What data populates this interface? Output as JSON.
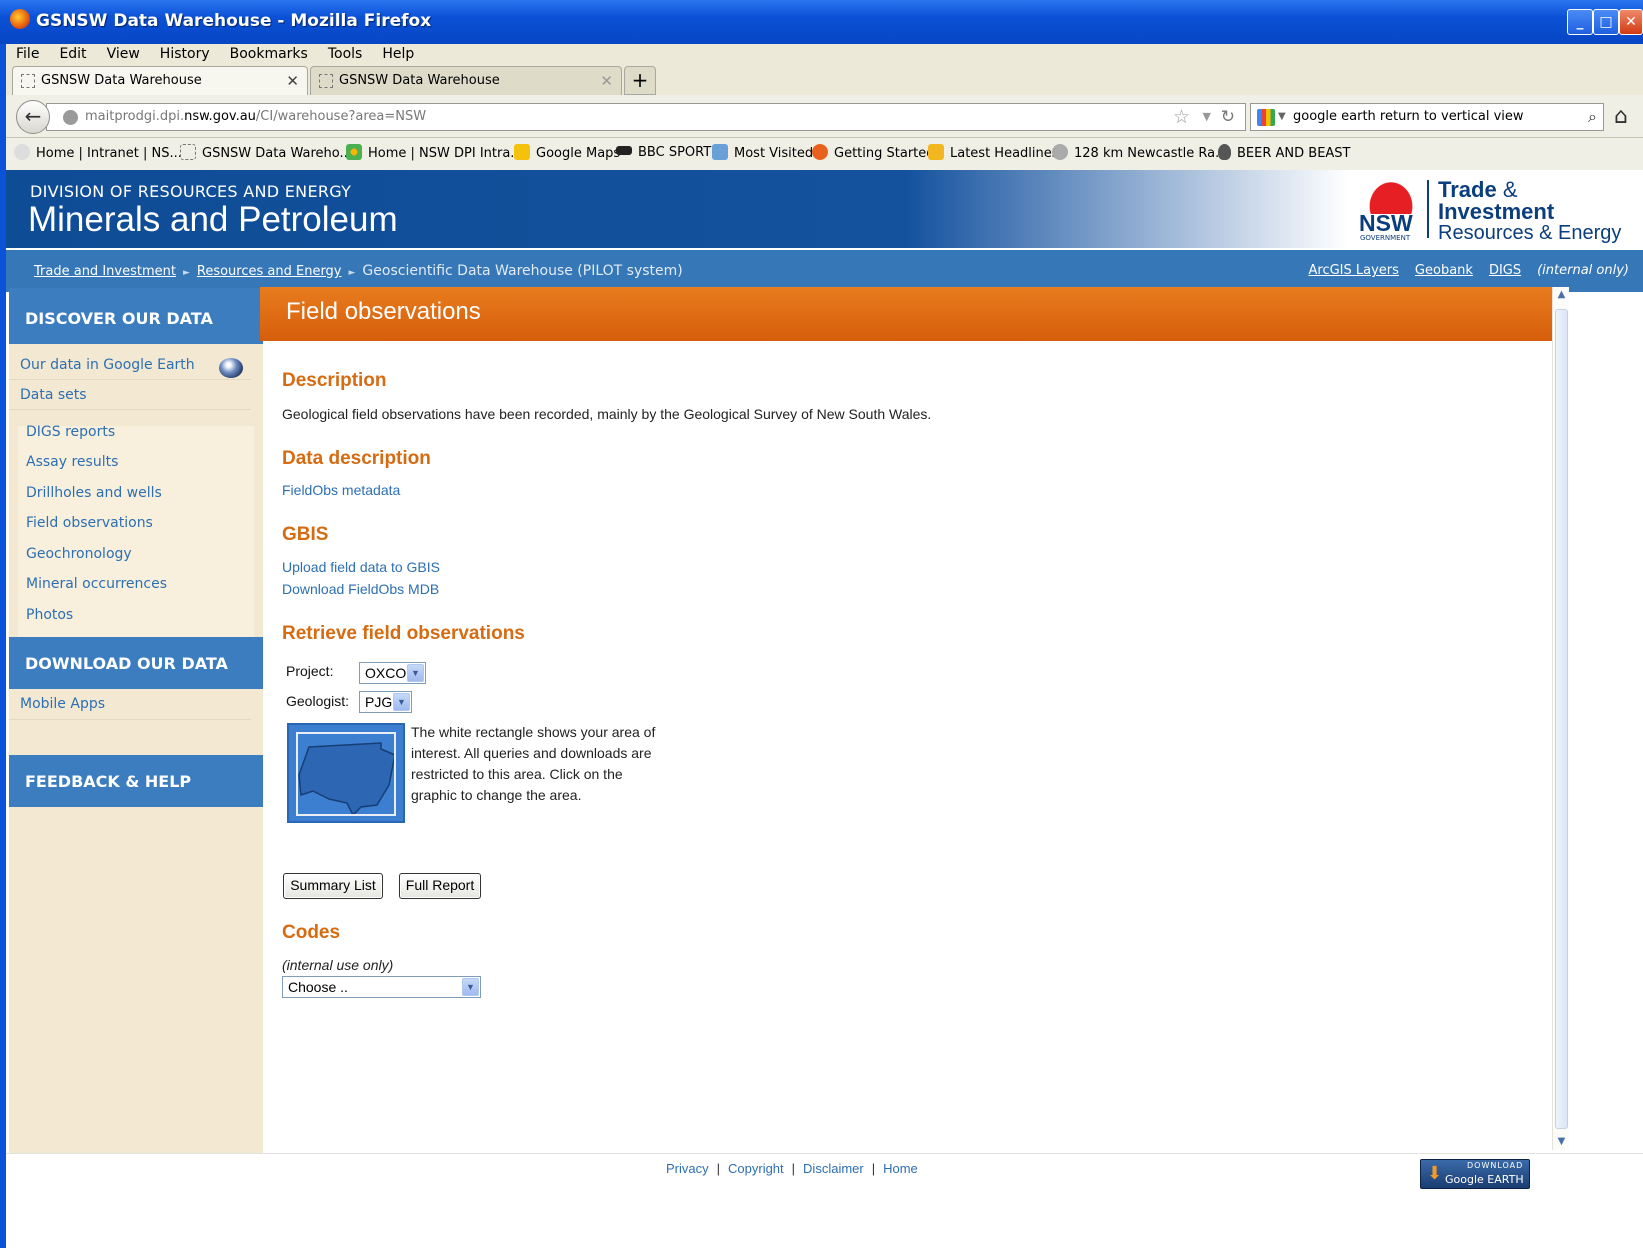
{
  "window": {
    "title": "GSNSW Data Warehouse - Mozilla Firefox"
  },
  "menu": [
    "File",
    "Edit",
    "View",
    "History",
    "Bookmarks",
    "Tools",
    "Help"
  ],
  "tabs": [
    {
      "label": "GSNSW Data Warehouse",
      "active": true
    },
    {
      "label": "GSNSW Data Warehouse",
      "active": false
    }
  ],
  "nav": {
    "url_prefix": "maitprodgi.dpi.",
    "url_domain": "nsw.gov.au",
    "url_path": "/CI/warehouse?area=NSW",
    "search_value": "google earth return to vertical view"
  },
  "bookmarks": [
    "Home | Intranet | NS...",
    "GSNSW Data Wareho...",
    "Home | NSW DPI Intra...",
    "Google Maps",
    "BBC SPORT",
    "Most Visited",
    "Getting Started",
    "Latest Headlines",
    "128 km Newcastle Ra...",
    "BEER AND BEAST"
  ],
  "banner": {
    "division": "DIVISION OF RESOURCES AND ENERGY",
    "title": "Minerals and Petroleum",
    "logo_nsw": "NSW",
    "logo_gov": "GOVERNMENT",
    "logo_trade": "Trade",
    "logo_amp": "&",
    "logo_investment": "Investment",
    "logo_resources": "Resources & Energy"
  },
  "breadcrumb": {
    "items": [
      "Trade and Investment",
      "Resources and Energy"
    ],
    "current": "Geoscientific Data Warehouse (PILOT system)",
    "right_links": [
      "ArcGIS Layers",
      "Geobank",
      "DIGS"
    ],
    "right_note": "(internal only)"
  },
  "sidebar": {
    "discover_heading": "DISCOVER OUR DATA",
    "top_items": [
      "Our data in Google Earth",
      "Data sets"
    ],
    "dataset_items": [
      "DIGS reports",
      "Assay results",
      "Drillholes and wells",
      "Field observations",
      "Geochronology",
      "Mineral occurrences",
      "Photos"
    ],
    "download_heading": "DOWNLOAD OUR DATA",
    "download_items": [
      "Mobile Apps"
    ],
    "feedback_heading": "FEEDBACK & HELP"
  },
  "main": {
    "page_title": "Field observations",
    "description_heading": "Description",
    "description_text": "Geological field observations have been recorded, mainly by the Geological Survey of New South Wales.",
    "data_description_heading": "Data description",
    "metadata_link": "FieldObs metadata",
    "gbis_heading": "GBIS",
    "gbis_links": [
      "Upload field data to GBIS",
      "Download FieldObs MDB"
    ],
    "retrieve_heading": "Retrieve field observations",
    "project_label": "Project:",
    "project_value": "OXCO",
    "geologist_label": "Geologist:",
    "geologist_value": "PJG",
    "area_text": "The white rectangle shows your area of interest. All queries and downloads are restricted to this area. Click on the graphic to change the area.",
    "summary_button": "Summary List",
    "report_button": "Full Report",
    "codes_heading": "Codes",
    "codes_note": "(internal use only)",
    "codes_value": "Choose .."
  },
  "footer": {
    "links": [
      "Privacy",
      "Copyright",
      "Disclaimer",
      "Home"
    ],
    "badge_top": "DOWNLOAD",
    "badge_bottom": "Google EARTH"
  },
  "colors": {
    "brand_blue": "#3677b8",
    "accent_orange": "#d66b12",
    "link_blue": "#2d6fb3",
    "sidebar_bg": "#f3e9d3"
  }
}
